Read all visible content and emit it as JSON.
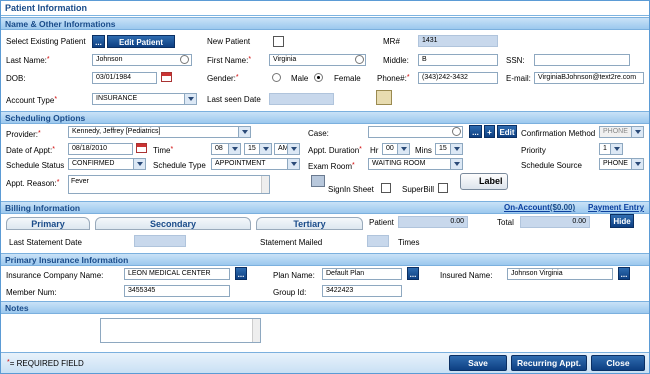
{
  "title": "Patient Information",
  "sections": {
    "name": "Name & Other Informations",
    "scheduling": "Scheduling Options",
    "billing": "Billing Information",
    "insurance": "Primary Insurance Information",
    "notes": "Notes"
  },
  "patient": {
    "select_existing_label": "Select Existing Patient",
    "dots": "...",
    "edit_patient_label": "Edit Patient",
    "new_patient_label": "New Patient",
    "mr_label": "MR#",
    "mr_value": "1431",
    "last_name_label": "Last Name:",
    "last_name_value": "Johnson",
    "first_name_label": "First Name:",
    "first_name_value": "Virginia",
    "middle_label": "Middle:",
    "middle_value": "B",
    "ssn_label": "SSN:",
    "ssn_value": "",
    "dob_label": "DOB:",
    "dob_value": "03/01/1984",
    "gender_label": "Gender:",
    "male_label": "Male",
    "female_label": "Female",
    "gender_selected": "Female",
    "phone_label": "Phone#:",
    "phone_value": "(343)242-3432",
    "email_label": "E-mail:",
    "email_value": "VirginiaBJohnson@text2re.com",
    "account_type_label": "Account Type",
    "account_type_value": "INSURANCE",
    "last_seen_label": "Last seen Date",
    "last_seen_value": ""
  },
  "scheduling": {
    "provider_label": "Provider:",
    "provider_value": "Kennedy, Jeffrey [Pediatrics]",
    "case_label": "Case:",
    "case_value": "",
    "plus": "+",
    "edit": "Edit",
    "confirmation_label": "Confirmation Method",
    "confirmation_value": "PHONE",
    "date_label": "Date of Appt:",
    "date_value": "08/18/2010",
    "time_label": "Time",
    "time_hour": "08",
    "time_min": "15",
    "time_ampm": "AM",
    "duration_label": "Appt. Duration",
    "hr_label": "Hr",
    "hr_value": "00",
    "mins_label": "Mins",
    "mins_value": "15",
    "priority_label": "Priority",
    "priority_value": "1",
    "status_label": "Schedule Status",
    "status_value": "CONFIRMED",
    "type_label": "Schedule Type",
    "type_value": "APPOINTMENT",
    "room_label": "Exam Room",
    "room_value": "WAITING ROOM",
    "source_label": "Schedule Source",
    "source_value": "PHONE",
    "reason_label": "Appt. Reason:",
    "reason_value": "Fever",
    "signin_label": "SignIn Sheet",
    "superbill_label": "SuperBill",
    "label_button": "Label"
  },
  "billing": {
    "on_account": "On-Account",
    "on_account_amount": "($0.00)",
    "payment_entry": "Payment Entry",
    "tabs": [
      "Primary",
      "Secondary",
      "Tertiary"
    ],
    "patient_label": "Patient",
    "patient_value": "0.00",
    "total_label": "Total",
    "total_value": "0.00",
    "hide_label": "Hide",
    "last_statement_label": "Last Statement Date",
    "statement_mailed_label": "Statement Mailed",
    "times_label": "Times"
  },
  "insurance": {
    "company_label": "Insurance Company Name:",
    "company_value": "LEON MEDICAL CENTER",
    "plan_label": "Plan Name:",
    "plan_value": "Default Plan",
    "insured_label": "Insured Name:",
    "insured_value": "Johnson Virginia",
    "member_label": "Member Num:",
    "member_value": "3455345",
    "group_label": "Group Id:",
    "group_value": "3422423"
  },
  "footer": {
    "required_note": "= REQUIRED FIELD",
    "save": "Save",
    "recurring": "Recurring Appt.",
    "close": "Close"
  },
  "colors": {
    "accent": "#1a4c8a",
    "button": "#0d3f82",
    "required": "#d00000",
    "grey_field": "#c8d8ec"
  }
}
